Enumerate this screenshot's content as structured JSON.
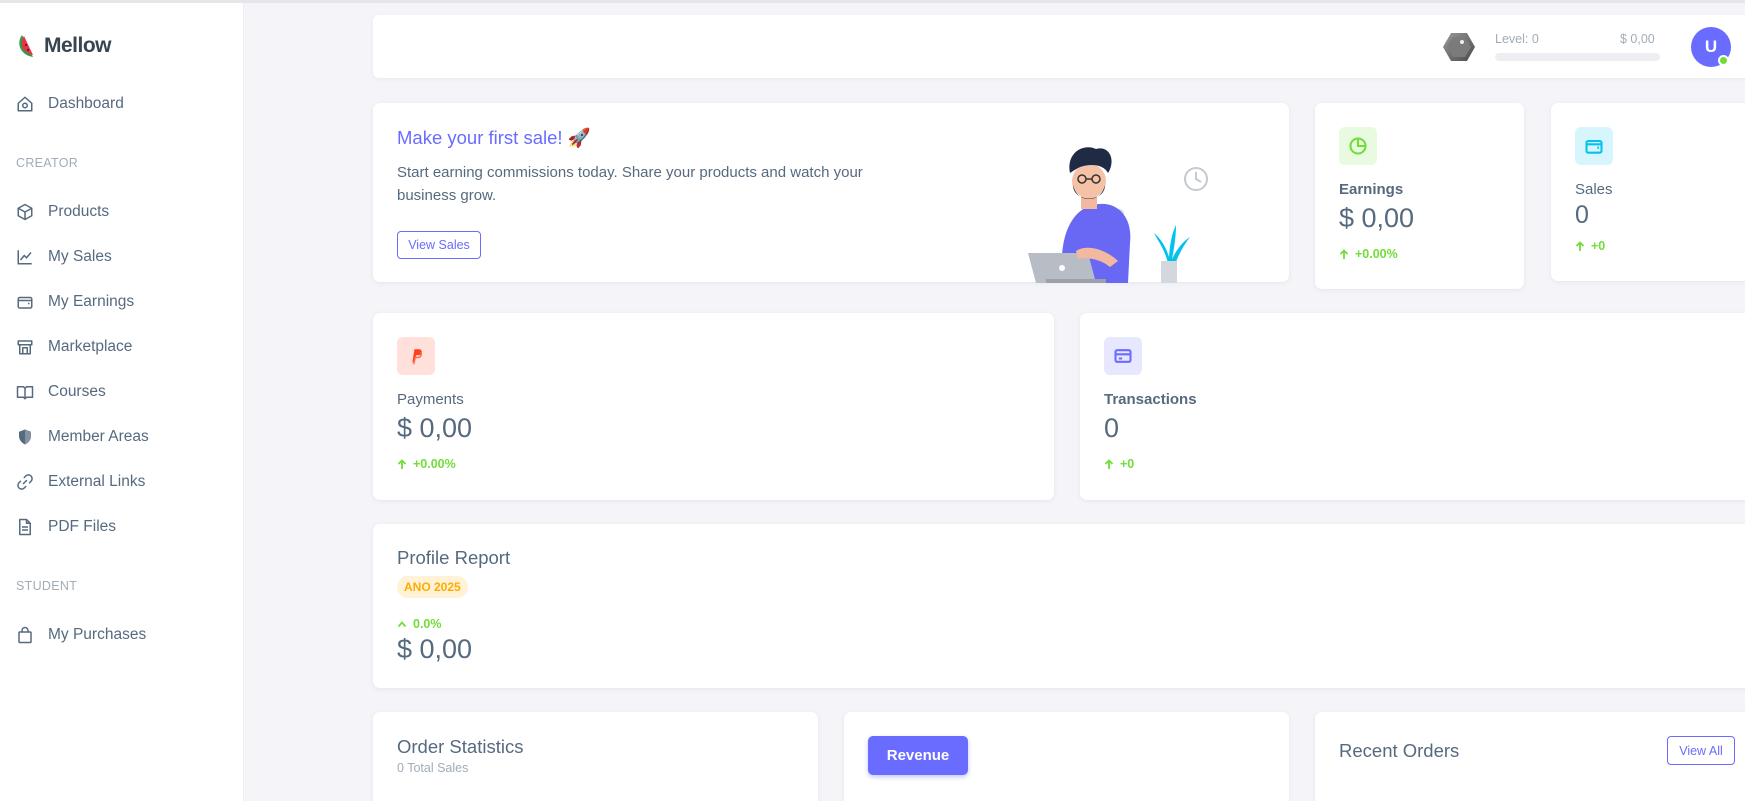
{
  "app": {
    "name": "Mellow"
  },
  "sidebar": {
    "dashboard": "Dashboard",
    "creator_label": "CREATOR",
    "creator_items": [
      {
        "label": "Products",
        "icon": "box-icon"
      },
      {
        "label": "My Sales",
        "icon": "chart-line-icon"
      },
      {
        "label": "My Earnings",
        "icon": "wallet-icon"
      },
      {
        "label": "Marketplace",
        "icon": "store-icon"
      },
      {
        "label": "Courses",
        "icon": "book-icon"
      },
      {
        "label": "Member Areas",
        "icon": "shield-icon"
      },
      {
        "label": "External Links",
        "icon": "link-icon"
      },
      {
        "label": "PDF Files",
        "icon": "file-icon"
      }
    ],
    "student_label": "STUDENT",
    "student_items": [
      {
        "label": "My Purchases",
        "icon": "shopping-bag-icon"
      }
    ]
  },
  "header": {
    "level": "Level: 0",
    "balance": "$ 0,00",
    "level_progress": 0,
    "avatar_initial": "U"
  },
  "welcome": {
    "title": "Make your first sale! 🚀",
    "text": "Start earning commissions today. Share your products and watch your business grow.",
    "button": "View Sales"
  },
  "stats": {
    "earnings": {
      "label": "Earnings",
      "value": "$ 0,00",
      "change": "+0.00%"
    },
    "sales": {
      "label": "Sales",
      "value": "0",
      "change": "+0"
    },
    "payments": {
      "label": "Payments",
      "value": "$ 0,00",
      "change": "+0.00%"
    },
    "transactions": {
      "label": "Transactions",
      "value": "0",
      "change": "+0"
    }
  },
  "profile_report": {
    "title": "Profile Report",
    "badge": "ANO 2025",
    "change": "0.0%",
    "value": "$ 0,00"
  },
  "order_statistics": {
    "title": "Order Statistics",
    "subtitle": "0 Total Sales"
  },
  "revenue": {
    "button": "Revenue"
  },
  "recent_orders": {
    "title": "Recent Orders",
    "button": "View All"
  },
  "colors": {
    "primary": "#696cff",
    "success": "#71dd37",
    "warning": "#ffab00",
    "danger": "#ff3e1d",
    "info": "#03c3ec",
    "text": "#566a7f"
  }
}
